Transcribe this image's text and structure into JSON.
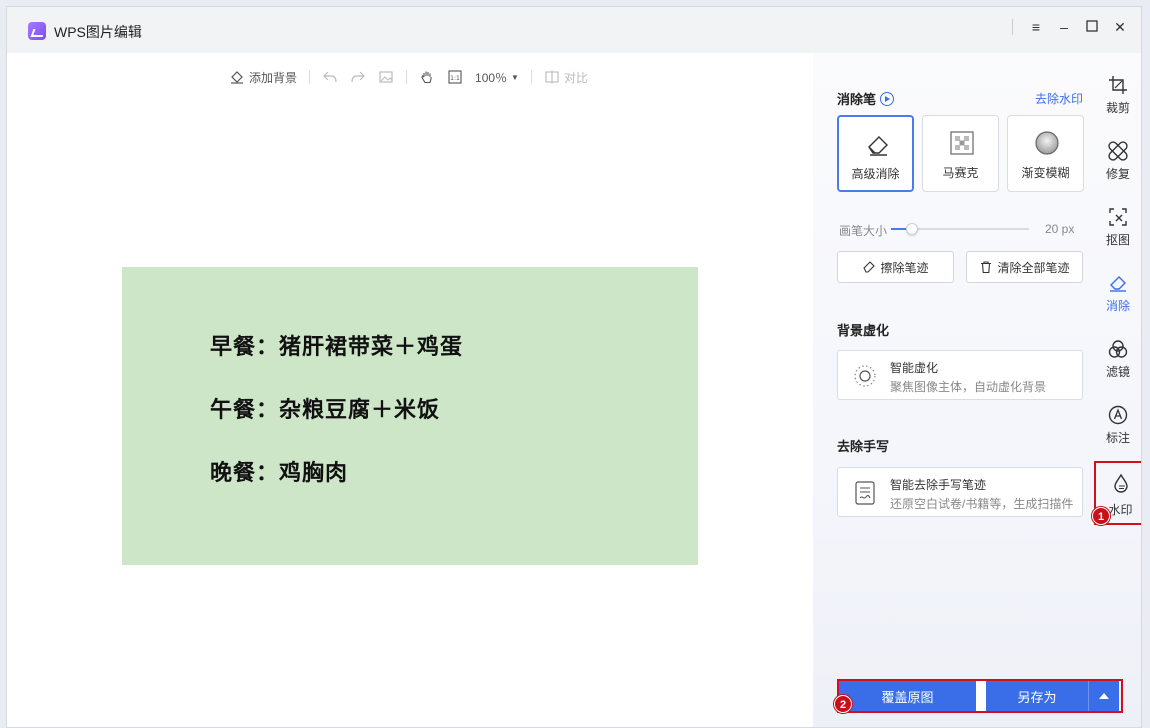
{
  "app": {
    "title": "WPS图片编辑"
  },
  "toolbar": {
    "add_background": "添加背景",
    "zoom": "100％",
    "compare": "对比"
  },
  "image_content": {
    "lines": [
      "早餐：猪肝裙带菜＋鸡蛋",
      "午餐：杂粮豆腐＋米饭",
      "晚餐：鸡胸肉"
    ],
    "background_color": "#cde6c8"
  },
  "panel": {
    "eraser_title": "消除笔",
    "remove_watermark_link": "去除水印",
    "tools": [
      {
        "label": "高级消除",
        "icon": "eraser-icon",
        "active": true
      },
      {
        "label": "马赛克",
        "icon": "mosaic-icon",
        "active": false
      },
      {
        "label": "渐变模糊",
        "icon": "gradient-blur-icon",
        "active": false
      }
    ],
    "brush_size_label": "画笔大小",
    "brush_size_value": "20 px",
    "brush_size_fraction": 0.15,
    "erase_strokes": "擦除笔迹",
    "clear_all_strokes": "清除全部笔迹",
    "bg_blur_title": "背景虚化",
    "smart_blur_title": "智能虚化",
    "smart_blur_desc": "聚焦图像主体，自动虚化背景",
    "handwriting_title": "去除手写",
    "smart_hw_title": "智能去除手写笔迹",
    "smart_hw_desc": "还原空白试卷/书籍等，生成扫描件"
  },
  "bottom": {
    "overwrite": "覆盖原图",
    "save_as": "另存为"
  },
  "sidebar": {
    "items": [
      {
        "label": "裁剪",
        "icon": "crop-icon"
      },
      {
        "label": "修复",
        "icon": "bandage-icon"
      },
      {
        "label": "抠图",
        "icon": "cutout-icon"
      },
      {
        "label": "消除",
        "icon": "eraser-icon"
      },
      {
        "label": "滤镜",
        "icon": "filter-icon"
      },
      {
        "label": "标注",
        "icon": "annotate-icon"
      },
      {
        "label": "水印",
        "icon": "watermark-icon"
      }
    ]
  },
  "badges": {
    "one": "1",
    "two": "2"
  },
  "colors": {
    "accent": "#3a6ee8",
    "highlight_red": "#d0101b"
  }
}
